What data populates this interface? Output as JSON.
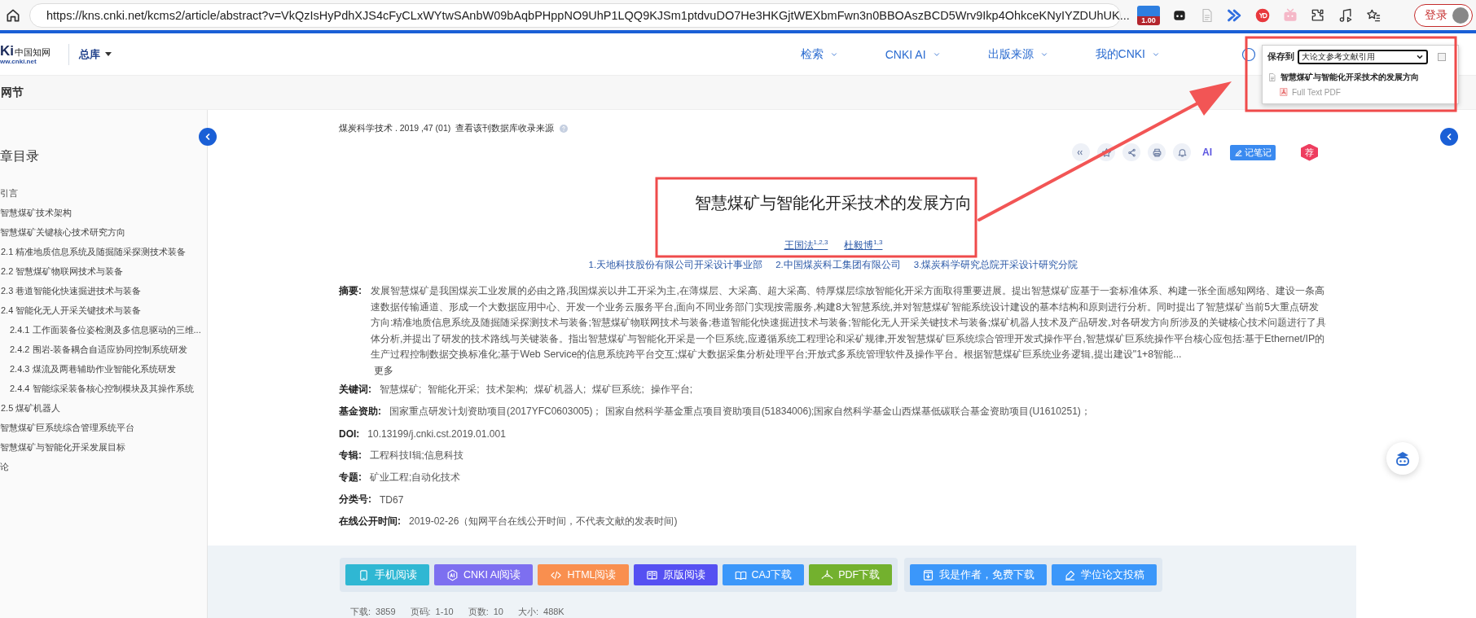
{
  "browser": {
    "url": "https://kns.cnki.net/kcms2/article/abstract?v=VkQzIsHyPdhXJS4cFyCLxWYtwSAnbW09bAqbPHppNO9UhP1LQQ9KJSm1ptdvuDO7He3HKGjtWEXbmFwn3n0BBOAszBCD5Wrv9Ikp4OhkceKNyIYZDUhUK...",
    "extension_badge": "1.00",
    "login": "登录"
  },
  "header": {
    "logo_mark": "Ki",
    "logo_name": "中国知网",
    "logo_url": "ww.cnki.net",
    "database": "总库",
    "nav": [
      "检索",
      "CNKI AI",
      "出版来源",
      "我的CNKI"
    ]
  },
  "page_title": "网节",
  "sidebar": {
    "title": "章目录",
    "items": [
      {
        "label": "引言"
      },
      {
        "label": "智慧煤矿技术架构"
      },
      {
        "label": "智慧煤矿关键核心技术研究方向",
        "children": [
          {
            "label": "2.1 精准地质信息系统及随掘随采探测技术装备"
          },
          {
            "label": "2.2 智慧煤矿物联网技术与装备"
          },
          {
            "label": "2.3 巷道智能化快速掘进技术与装备"
          },
          {
            "label": "2.4 智能化无人开采关键技术与装备",
            "children": [
              {
                "label": "2.4.1 工作面装备位姿检测及多信息驱动的三维..."
              },
              {
                "label": "2.4.2 围岩-装备耦合自适应协同控制系统研发"
              },
              {
                "label": "2.4.3 煤流及两巷辅助作业智能化系统研发"
              },
              {
                "label": "2.4.4 智能综采装备核心控制模块及其操作系统"
              }
            ]
          },
          {
            "label": "2.5 煤矿机器人"
          }
        ]
      },
      {
        "label": "智慧煤矿巨系统综合管理系统平台"
      },
      {
        "label": "智慧煤矿与智能化开采发展目标"
      },
      {
        "label": "论"
      }
    ]
  },
  "article": {
    "source": "煤炭科学技术 . 2019 ,47 (01)",
    "source_link": "查看该刊数据库收录来源",
    "ai_label": "AI",
    "note_button": "记笔记",
    "recommend_badge": "荐",
    "title": "智慧煤矿与智能化开采技术的发展方向",
    "authors": [
      "王国法$^{1,2,3}$",
      "杜毅博$^{1,3}$"
    ],
    "affiliations": [
      "1.天地科技股份有限公司开采设计事业部",
      "2.中国煤炭科工集团有限公司",
      "3.煤炭科学研究总院开采设计研究分院"
    ],
    "abstract_label": "摘要:",
    "abstract": "发展智慧煤矿是我国煤炭工业发展的必由之路,我国煤炭以井工开采为主,在薄煤层、大采高、超大采高、特厚煤层综放智能化开采方面取得重要进展。提出智慧煤矿应基于一套标准体系、构建一张全面感知网络、建设一条高速数据传输通道、形成一个大数据应用中心、开发一个业务云服务平台,面向不同业务部门实现按需服务,构建8大智慧系统,并对智慧煤矿智能系统设计建设的基本结构和原则进行分析。同时提出了智慧煤矿当前5大重点研发方向:精准地质信息系统及随掘随采探测技术与装备;智慧煤矿物联网技术与装备;巷道智能化快速掘进技术与装备;智能化无人开采关键技术与装备;煤矿机器人技术及产品研发,对各研发方向所涉及的关键核心技术问题进行了具体分析,并提出了研发的技术路线与关键装备。指出智慧煤矿与智能化开采是一个巨系统,应遵循系统工程理论和采矿规律,开发智慧煤矿巨系统综合管理开发式操作平台,智慧煤矿巨系统操作平台核心应包括:基于Ethernet/IP的生产过程控制数据交换标准化;基于Web Service的信息系统跨平台交互;煤矿大数据采集分析处理平台;开放式多系统管理软件及操作平台。根据智慧煤矿巨系统业务逻辑,提出建设\"1+8智能...",
    "more": "更多",
    "fields": [
      {
        "kind": "keywords",
        "label": "关键词:",
        "items": [
          "智慧煤矿;",
          "智能化开采;",
          "技术架构;",
          "煤矿机器人;",
          "煤矿巨系统;",
          "操作平台;"
        ]
      },
      {
        "kind": "text",
        "label": "基金资助:",
        "value": "国家重点研发计划资助项目(2017YFC0603005)；  国家自然科学基金重点项目资助项目(51834006);国家自然科学基金山西煤基低碳联合基金资助项目(U1610251)；"
      },
      {
        "kind": "text",
        "label": "DOI:",
        "value": "10.13199/j.cnki.cst.2019.01.001"
      },
      {
        "kind": "text",
        "label": "专辑:",
        "value": "工程科技Ⅰ辑;信息科技"
      },
      {
        "kind": "text",
        "label": "专题:",
        "value": "矿业工程;自动化技术"
      },
      {
        "kind": "text",
        "label": "分类号:",
        "value": "TD67"
      },
      {
        "kind": "text",
        "label": "在线公开时间:",
        "value": "2019-02-26（知网平台在线公开时间，不代表文献的发表时间)"
      }
    ],
    "read_buttons": [
      {
        "label": "手机阅读",
        "kind": "mobile",
        "color": "#2fb7d3"
      },
      {
        "label": "CNKI AI阅读",
        "kind": "ai",
        "color": "#7d6ff0"
      },
      {
        "label": "HTML阅读",
        "kind": "html",
        "color": "#f98f4f"
      },
      {
        "label": "原版阅读",
        "kind": "original",
        "color": "#5550f2"
      },
      {
        "label": "CAJ下载",
        "kind": "caj",
        "color": "#3b97fa"
      },
      {
        "label": "PDF下载",
        "kind": "pdf",
        "color": "#73b12e"
      }
    ],
    "author_buttons": [
      {
        "label": "我是作者，免费下载",
        "kind": "author",
        "color": "#3b97fa"
      },
      {
        "label": "学位论文投稿",
        "kind": "submit",
        "color": "#3b97fa"
      }
    ],
    "stats": [
      {
        "label": "下载:",
        "value": "3859"
      },
      {
        "label": "页码:",
        "value": "1-10"
      },
      {
        "label": "页数:",
        "value": "10"
      },
      {
        "label": "大小:",
        "value": "488K"
      }
    ]
  },
  "save_popup": {
    "label": "保存到",
    "folder": "大论文参考文献引用",
    "item_title": "智慧煤矿与智能化开采技术的发展方向",
    "attachment": "Full Text PDF"
  }
}
